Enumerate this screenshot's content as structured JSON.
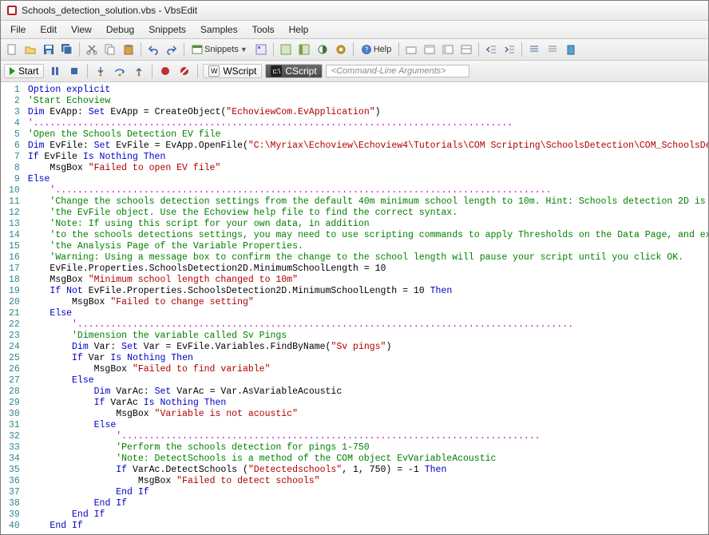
{
  "title": "Schools_detection_solution.vbs - VbsEdit",
  "menu": [
    "File",
    "Edit",
    "View",
    "Debug",
    "Snippets",
    "Samples",
    "Tools",
    "Help"
  ],
  "toolbar1": {
    "snippets": "Snippets",
    "help": "Help"
  },
  "toolbar2": {
    "start": "Start",
    "wscript": "WScript",
    "cscript": "CScript",
    "args_placeholder": "<Command-Line Arguments>"
  },
  "code": [
    {
      "n": 1,
      "t": [
        "kw:Option explicit"
      ]
    },
    {
      "n": 2,
      "t": [
        "cm:'Start Echoview"
      ]
    },
    {
      "n": 3,
      "t": [
        "kw:Dim",
        " EvApp: ",
        "kw:Set",
        " EvApp = CreateObject(",
        "str:\"EchoviewCom.EvApplication\"",
        ")"
      ]
    },
    {
      "n": 4,
      "t": [
        "cm-dots:'......................................................................................."
      ]
    },
    {
      "n": 5,
      "t": [
        "cm:'Open the Schools Detection EV file"
      ]
    },
    {
      "n": 6,
      "t": [
        "kw:Dim",
        " EvFile: ",
        "kw:Set",
        " EvFile = EvApp.OpenFile(",
        "str:\"C:\\Myriax\\Echoview\\Echoview4\\Tutorials\\COM Scripting\\SchoolsDetection\\COM_SchoolsDetection.EV\"",
        ")"
      ]
    },
    {
      "n": 7,
      "t": [
        "kw:If",
        " EvFile ",
        "kw:Is Nothing Then"
      ]
    },
    {
      "n": 8,
      "t": [
        "    MsgBox ",
        "str:\"Failed to open EV file\""
      ]
    },
    {
      "n": 9,
      "t": [
        "kw:Else"
      ]
    },
    {
      "n": 10,
      "t": [
        "    ",
        "cm-dots:'.........................................................................................."
      ]
    },
    {
      "n": 11,
      "t": [
        "    ",
        "cm:'Change the schools detection settings from the default 40m minimum school length to 10m. Hint: Schools detection 2D is a property of"
      ]
    },
    {
      "n": 12,
      "t": [
        "    ",
        "cm:'the EvFile object. Use the Echoview help file to find the correct syntax."
      ]
    },
    {
      "n": 13,
      "t": [
        "    ",
        "cm:'Note: If using this script for your own data, in addition"
      ]
    },
    {
      "n": 14,
      "t": [
        "    ",
        "cm:'to the schools detections settings, you may need to use scripting commands to apply Thresholds on the Data Page, and exclusions on"
      ]
    },
    {
      "n": 15,
      "t": [
        "    ",
        "cm:'the Analysis Page of the Variable Properties."
      ]
    },
    {
      "n": 16,
      "t": [
        "    ",
        "cm:'Warning: Using a message box to confirm the change to the school length will pause your script until you click OK."
      ]
    },
    {
      "n": 17,
      "t": [
        "    EvFile.Properties.SchoolsDetection2D.MinimumSchoolLength = 10"
      ]
    },
    {
      "n": 18,
      "t": [
        "    MsgBox ",
        "str:\"Minimum school length changed to 10m\""
      ]
    },
    {
      "n": 19,
      "t": [
        "    ",
        "kw:If Not",
        " EvFile.Properties.SchoolsDetection2D.MinimumSchoolLength = 10 ",
        "kw:Then"
      ]
    },
    {
      "n": 20,
      "t": [
        "        MsgBox ",
        "str:\"Failed to change setting\""
      ]
    },
    {
      "n": 21,
      "t": [
        "    ",
        "kw:Else"
      ]
    },
    {
      "n": 22,
      "t": [
        "        ",
        "cm-dots:'.........................................................................................."
      ]
    },
    {
      "n": 23,
      "t": [
        "        ",
        "cm:'Dimension the variable called Sv Pings"
      ]
    },
    {
      "n": 24,
      "t": [
        "        ",
        "kw:Dim",
        " Var: ",
        "kw:Set",
        " Var = EvFile.Variables.FindByName(",
        "str:\"Sv pings\"",
        ")"
      ]
    },
    {
      "n": 25,
      "t": [
        "        ",
        "kw:If",
        " Var ",
        "kw:Is Nothing Then"
      ]
    },
    {
      "n": 26,
      "t": [
        "            MsgBox ",
        "str:\"Failed to find variable\""
      ]
    },
    {
      "n": 27,
      "t": [
        "        ",
        "kw:Else"
      ]
    },
    {
      "n": 28,
      "t": [
        "            ",
        "kw:Dim",
        " VarAc: ",
        "kw:Set",
        " VarAc = Var.AsVariableAcoustic"
      ]
    },
    {
      "n": 29,
      "t": [
        "            ",
        "kw:If",
        " VarAc ",
        "kw:Is Nothing Then"
      ]
    },
    {
      "n": 30,
      "t": [
        "                MsgBox ",
        "str:\"Variable is not acoustic\""
      ]
    },
    {
      "n": 31,
      "t": [
        "            ",
        "kw:Else"
      ]
    },
    {
      "n": 32,
      "t": [
        "                ",
        "cm-dots:'............................................................................"
      ]
    },
    {
      "n": 33,
      "t": [
        "                ",
        "cm:'Perform the schools detection for pings 1-750"
      ]
    },
    {
      "n": 34,
      "t": [
        "                ",
        "cm:'Note: DetectSchools is a method of the COM object EvVariableAcoustic"
      ]
    },
    {
      "n": 35,
      "t": [
        "                ",
        "kw:If",
        " VarAc.DetectSchools (",
        "str:\"Detectedschools\"",
        ", 1, 750) = -1 ",
        "kw:Then"
      ]
    },
    {
      "n": 36,
      "t": [
        "                    MsgBox ",
        "str:\"Failed to detect schools\""
      ]
    },
    {
      "n": 37,
      "t": [
        "                ",
        "kw:End If"
      ]
    },
    {
      "n": 38,
      "t": [
        "            ",
        "kw:End If"
      ]
    },
    {
      "n": 39,
      "t": [
        "        ",
        "kw:End If"
      ]
    },
    {
      "n": 40,
      "t": [
        "    ",
        "kw:End If"
      ]
    }
  ]
}
